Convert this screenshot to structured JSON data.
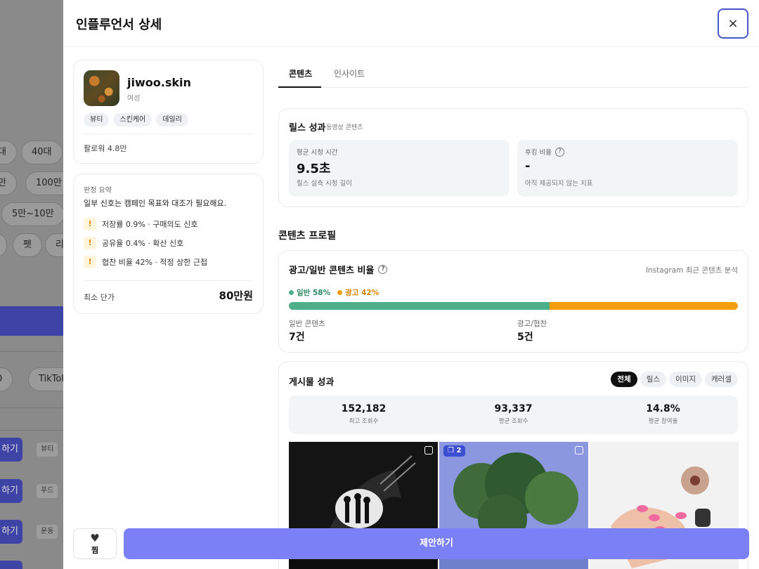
{
  "background": {
    "pills": [
      "대",
      "40대",
      "만",
      "100만 ~",
      "5만~10만",
      "",
      "펫",
      "리",
      "0",
      "TikTok"
    ],
    "row_buttons": [
      "하기",
      "하기",
      "하기"
    ],
    "row_tags": [
      "뷰티",
      "푸드",
      "운동"
    ]
  },
  "drawer": {
    "title": "인플루언서 상세",
    "close_icon": "×"
  },
  "profile": {
    "username": "jiwoo.skin",
    "gender": "여성",
    "tags": [
      "뷰티",
      "스킨케어",
      "데일리"
    ],
    "followers": "팔로워 4.8만"
  },
  "judgement": {
    "label": "판정 요약",
    "summary": "일부 신호는 캠페인 목표와 대조가 필요해요.",
    "signals": [
      "저장률 0.9% · 구매의도 신호",
      "공유율 0.4% · 확산 신호",
      "협찬 비율 42% · 적정 상한 근접"
    ],
    "warn_glyph": "!",
    "price_label": "최소 단가",
    "price": "80만원"
  },
  "tabs": [
    {
      "label": "콘텐츠",
      "active": true
    },
    {
      "label": "인사이트",
      "active": false
    }
  ],
  "reels": {
    "title": "릴스 성과",
    "subtitle": "동영상 콘텐츠",
    "metrics": [
      {
        "label": "평균 시청 시간",
        "value": "9.5초",
        "desc": "릴스 실측 시청 길이",
        "help": false
      },
      {
        "label": "후킹 비율",
        "value": "-",
        "desc": "아직 제공되지 않는 지표",
        "help": true
      }
    ]
  },
  "content_profile": {
    "heading": "콘텐츠 프로필",
    "ad_ratio": {
      "title": "광고/일반 콘텐츠 비율",
      "source": "Instagram 최근 콘텐츠 분석",
      "legend": [
        {
          "label": "일반 58%",
          "color": "#4caf8a"
        },
        {
          "label": "광고 42%",
          "color": "#f59e0b"
        }
      ],
      "general_pct": 58,
      "ad_pct": 42,
      "general_label": "일반 콘텐츠",
      "general_count": "7건",
      "ad_label": "광고/협찬",
      "ad_count": "5건"
    }
  },
  "posts": {
    "title": "게시물 성과",
    "filters": [
      {
        "label": "전체",
        "active": true
      },
      {
        "label": "릴스",
        "active": false
      },
      {
        "label": "이미지",
        "active": false
      },
      {
        "label": "캐러셀",
        "active": false
      }
    ],
    "stats": [
      {
        "value": "152,182",
        "label": "최고 조회수"
      },
      {
        "value": "93,337",
        "label": "평균 조회수"
      },
      {
        "value": "14.8%",
        "label": "평균 참여율"
      }
    ],
    "carousel_badge": "2"
  },
  "footer": {
    "wish_label": "찜",
    "propose_label": "제안하기"
  },
  "colors": {
    "accent": "#7b80f6",
    "general": "#4caf8a",
    "ad": "#f59e0b"
  }
}
